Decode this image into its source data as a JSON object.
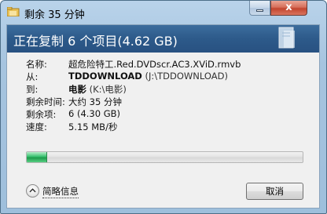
{
  "window": {
    "title": "剩余 35 分钟",
    "close_label": "x"
  },
  "header": {
    "title": "正在复制 6 个项目(4.62 GB)"
  },
  "details": {
    "name": {
      "label": "名称:",
      "value": "超危险特工.Red.DVDscr.AC3.XViD.rmvb"
    },
    "from": {
      "label": "从:",
      "value": "TDDOWNLOAD",
      "path": "(J:\\TDDOWNLOAD)"
    },
    "to": {
      "label": "到:",
      "value": "电影",
      "path": "(K:\\电影)"
    },
    "time_remaining": {
      "label": "剩余时间:",
      "value": "大约 35 分钟"
    },
    "items_remaining": {
      "label": "剩余项:",
      "value": "6 (4.30 GB)"
    },
    "speed": {
      "label": "速度:",
      "value": "5.15 MB/秒"
    }
  },
  "progress": {
    "fraction": 0.07
  },
  "footer": {
    "details_toggle_label": "简略信息",
    "cancel_label": "取消"
  },
  "colors": {
    "header_bg": "#2d5a8a",
    "progress_green": "#37c06e",
    "close_red": "#c2452e"
  },
  "icons": {
    "title": "folder-copy-icon",
    "header": "document-transfer-icon",
    "toggle": "chevron-up-icon"
  }
}
